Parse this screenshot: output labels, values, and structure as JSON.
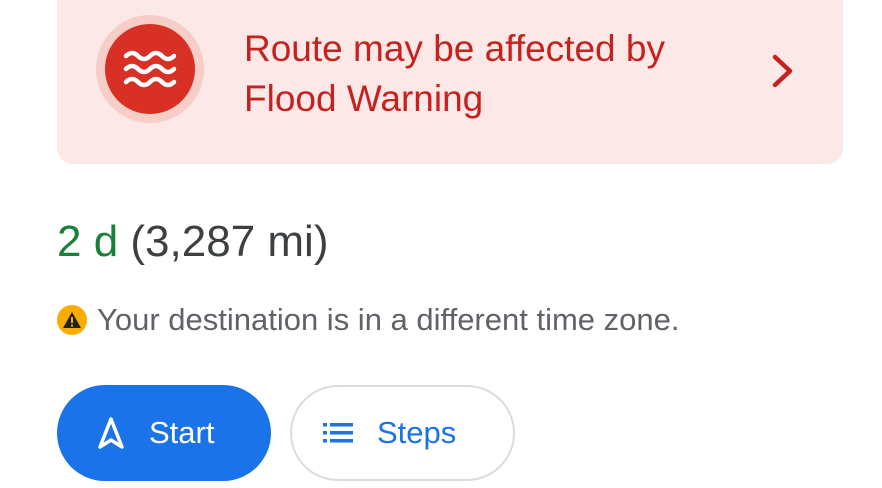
{
  "alert": {
    "line1": "Route may be affected by",
    "line2": "Flood Warning",
    "icon": "flood-waves-icon",
    "chevron_icon": "chevron-right-icon",
    "background_color": "#fce8e6",
    "accent_color": "#d93025",
    "text_color": "#c5221f"
  },
  "trip": {
    "duration": "2 d",
    "distance": "(3,287 mi)",
    "duration_color": "#188038"
  },
  "notice": {
    "icon": "warning-icon",
    "text": "Your destination is in a different time zone.",
    "icon_color": "#f9ab00"
  },
  "actions": {
    "start": {
      "label": "Start",
      "icon": "navigation-arrow-icon",
      "color": "#1a73e8"
    },
    "steps": {
      "label": "Steps",
      "icon": "list-icon"
    }
  }
}
